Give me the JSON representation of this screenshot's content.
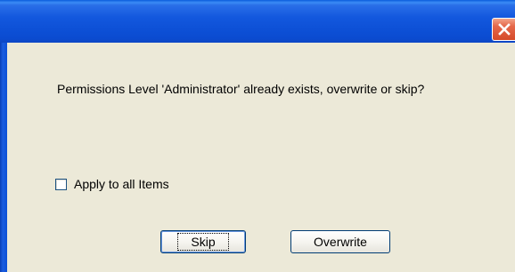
{
  "window": {
    "title": "",
    "close_icon": "close-icon",
    "colors": {
      "titlebar": "#0d50d6",
      "close_button": "#e5684a",
      "dialog_background": "#ece9d8"
    }
  },
  "dialog": {
    "message": "Permissions Level 'Administrator' already exists, overwrite or skip?",
    "apply_all": {
      "label": "Apply to all Items",
      "checked": false
    },
    "buttons": {
      "skip_label": "Skip",
      "overwrite_label": "Overwrite"
    }
  }
}
